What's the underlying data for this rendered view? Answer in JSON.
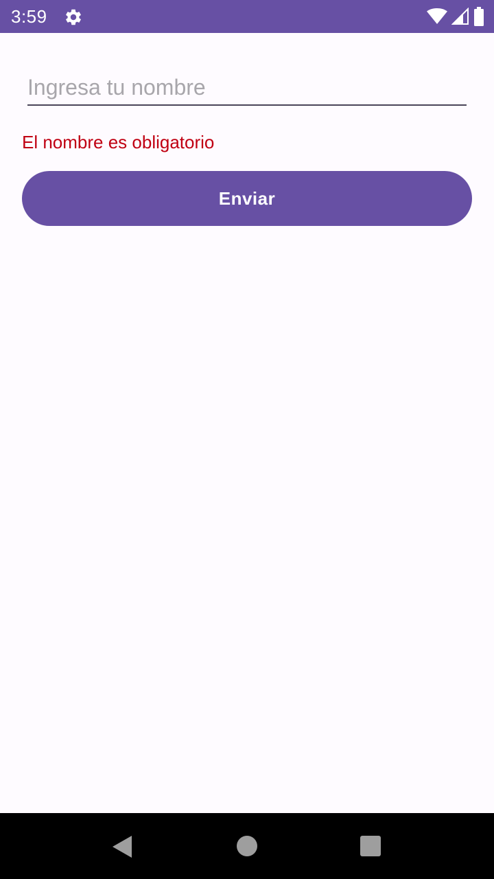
{
  "status_bar": {
    "time": "3:59",
    "background_color": "#6750A4",
    "icons": [
      "gear-icon",
      "wifi-icon",
      "cellular-signal-icon",
      "battery-icon"
    ]
  },
  "form": {
    "name_input": {
      "value": "",
      "placeholder": "Ingresa tu nombre"
    },
    "error_message": "El nombre es obligatorio",
    "error_color": "#C00012",
    "submit_label": "Enviar",
    "accent_color": "#6750A4"
  },
  "navigation_bar": {
    "icons": [
      "back-icon",
      "home-icon",
      "recents-icon"
    ]
  }
}
